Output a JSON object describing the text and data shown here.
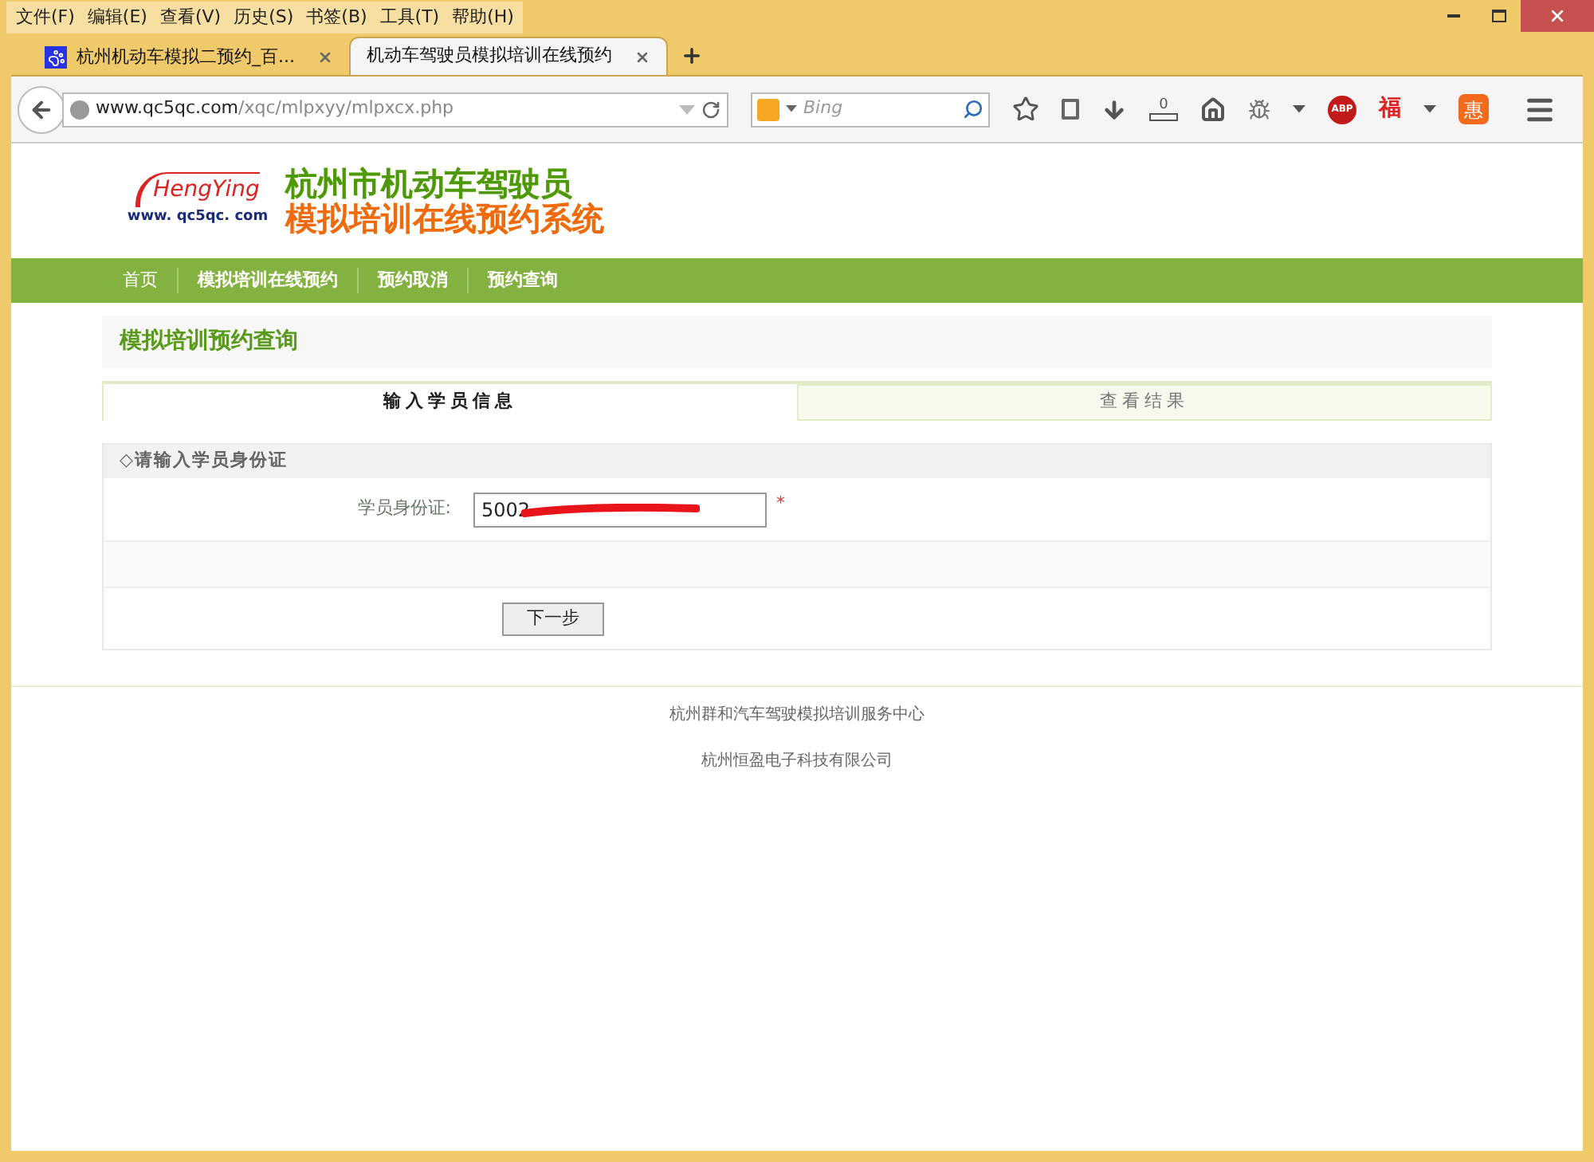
{
  "menu_bar": [
    "文件(F)",
    "编辑(E)",
    "查看(V)",
    "历史(S)",
    "书签(B)",
    "工具(T)",
    "帮助(H)"
  ],
  "browser_tabs": [
    {
      "title": "杭州机动车模拟二预约_百...",
      "selected": false
    },
    {
      "title": "机动车驾驶员模拟培训在线预约",
      "selected": true
    }
  ],
  "address_bar": {
    "domain": "www.qc5qc.com",
    "path": "/xqc/mlpxyy/mlpxcx.php"
  },
  "search": {
    "placeholder": "Bing"
  },
  "toolbar": {
    "download_count": "0",
    "adblock_label": "ABP",
    "fu_label": "福",
    "hui_label": "惠"
  },
  "site": {
    "logo_brand": "HengYing",
    "logo_url": "www. qc5qc. com",
    "title_line1": "杭州市机动车驾驶员",
    "title_line2": "模拟培训在线预约系统"
  },
  "nav": [
    {
      "label": "首页"
    },
    {
      "label": "模拟培训在线预约"
    },
    {
      "label": "预约取消"
    },
    {
      "label": "预约查询"
    }
  ],
  "page_title": "模拟培训预约查询",
  "steps": [
    {
      "label": "输入学员信息",
      "selected": true
    },
    {
      "label": "查看结果",
      "selected": false
    }
  ],
  "form": {
    "section_title": "◇请输入学员身份证",
    "id_label": "学员身份证:",
    "id_value": "5002",
    "required_mark": "*",
    "next_button": "下一步"
  },
  "footer": [
    "杭州群和汽车驾驶模拟培训服务中心",
    "杭州恒盈电子科技有限公司"
  ]
}
